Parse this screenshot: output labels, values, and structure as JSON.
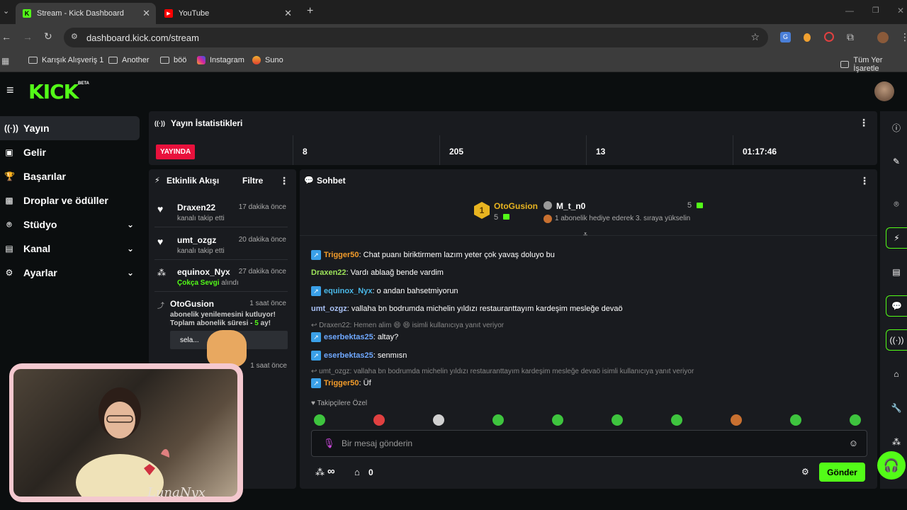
{
  "browser": {
    "tabs": [
      {
        "title": "Stream - Kick Dashboard",
        "favicon": "K",
        "active": true
      },
      {
        "title": "YouTube",
        "favicon": "▶",
        "active": false
      }
    ],
    "url": "dashboard.kick.com/stream",
    "bookmarks": [
      "Karışık Alışveriş 1",
      "Another",
      "böö",
      "Instagram",
      "Suno"
    ],
    "bookmarks_right": "Tüm Yer İşaretle"
  },
  "kick": {
    "logo": "KICK",
    "beta": "BETA",
    "accent": "#53fc18"
  },
  "sidebar": {
    "items": [
      {
        "label": "Yayın",
        "icon": "broadcast-icon"
      },
      {
        "label": "Gelir",
        "icon": "revenue-icon"
      },
      {
        "label": "Başarılar",
        "icon": "trophy-icon"
      },
      {
        "label": "Droplar ve ödüller",
        "icon": "gift-icon"
      },
      {
        "label": "Stüdyo",
        "icon": "studio-icon"
      },
      {
        "label": "Kanal",
        "icon": "channel-icon"
      },
      {
        "label": "Ayarlar",
        "icon": "gear-icon"
      }
    ]
  },
  "stats": {
    "title": "Yayın İstatistikleri",
    "live": "YAYINDA",
    "values": [
      "8",
      "205",
      "13",
      "01:17:46"
    ]
  },
  "activity": {
    "title": "Etkinlik Akışı",
    "filter": "Filtre",
    "items": [
      {
        "user": "Draxen22",
        "time": "17 dakika önce",
        "text": "kanalı takip etti"
      },
      {
        "user": "umt_ozgz",
        "time": "20 dakika önce",
        "text": "kanalı takip etti"
      },
      {
        "user": "equinox_Nyx",
        "time": "27 dakika önce",
        "text_pre": "Çokça Sevgi",
        "text_post": " alındı"
      },
      {
        "user": "OtoGusion",
        "time": "1 saat önce",
        "line1": "abonelik yenilemesini kutluyor!",
        "line2_pre": "Toplam abonelik süresi - ",
        "line2_num": "5",
        "line2_post": " ay!",
        "reply": "sela..."
      },
      {
        "time": "1 saat önce"
      }
    ]
  },
  "chat": {
    "title": "Sohbet",
    "pinned": {
      "rank": "1",
      "user1": "OtoGusion",
      "count1": "5",
      "user2": "M_t_n0",
      "count2": "5",
      "note": "1 abonelik hediye ederek 3. sıraya yükselin"
    },
    "messages": [
      {
        "user": "Trigger50",
        "color": "#f39c2a",
        "text": ": Chat puanı biriktirmem lazım yeter çok yavaş doluyo bu",
        "badge": true
      },
      {
        "user": "Draxen22",
        "color": "#9de35a",
        "text": ": Vardı ablaağ bende vardim",
        "badge": false
      },
      {
        "user": "equinox_Nyx",
        "color": "#4ab8e8",
        "text": ": o andan bahsetmiyorun",
        "badge": true
      },
      {
        "user": "umt_ozgz",
        "color": "#a9c1f5",
        "text": ": vallaha bn bodrumda michelin yıldızı restauranttayım kardeşim mesleğe devaö",
        "badge": false
      },
      {
        "reply": "Draxen22: Hemen alim 😄 😄 isimli kullanıcıya yanıt veriyor"
      },
      {
        "user": "eserbektas25",
        "color": "#6fa8ff",
        "text": ": altay?",
        "badge": true
      },
      {
        "user": "eserbektas25",
        "color": "#6fa8ff",
        "text": ": senmısn",
        "badge": true
      },
      {
        "reply": "umt_ozgz: vallaha bn bodrumda michelin yıldızı restauranttayım kardeşim mesleğe devaö isimli kullanıcıya yanıt veriyor"
      },
      {
        "user": "Trigger50",
        "color": "#f39c2a",
        "text": ": Üf",
        "badge": true
      }
    ],
    "followers_only": "Takipçilere Özel",
    "placeholder": "Bir mesaj gönderin",
    "points": "∞",
    "store_count": "0",
    "send": "Gönder"
  },
  "overlay": {
    "signature": "LunaNyx"
  }
}
